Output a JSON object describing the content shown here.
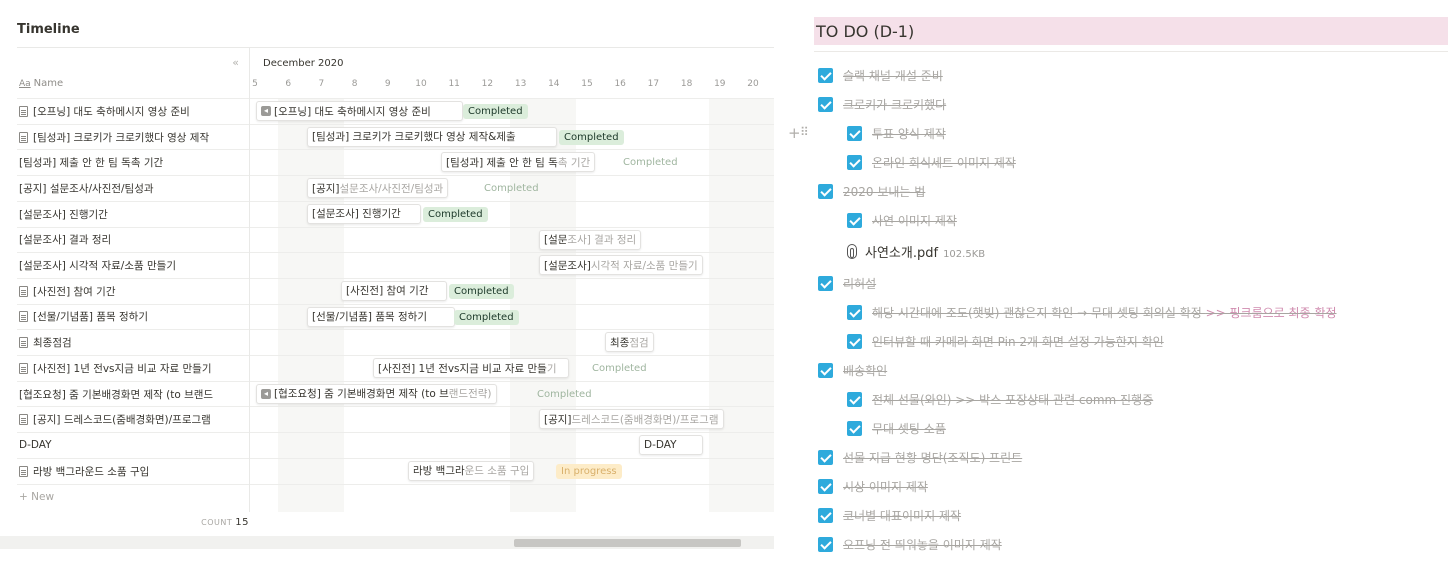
{
  "timeline": {
    "title": "Timeline",
    "collapse_icon": "«",
    "name_header_icon": "Aa",
    "name_header": "Name",
    "month": "December 2020",
    "days": [
      "5",
      "6",
      "7",
      "8",
      "9",
      "10",
      "11",
      "12",
      "13",
      "14",
      "15",
      "16",
      "17",
      "18",
      "19",
      "20"
    ],
    "rows": [
      {
        "name": "[오프닝] 대도 축하메시지 영상 준비",
        "doc": true
      },
      {
        "name": "[팀성과] 크로키가 크로키했다 영상 제작",
        "doc": true
      },
      {
        "name": "[팀성과] 제출 안 한 팀 독촉 기간",
        "doc": false
      },
      {
        "name": "[공지] 설문조사/사진전/팀성과",
        "doc": false
      },
      {
        "name": "[설문조사] 진행기간",
        "doc": false
      },
      {
        "name": "[설문조사] 결과 정리",
        "doc": false
      },
      {
        "name": "[설문조사] 시각적 자료/소품 만들기",
        "doc": false
      },
      {
        "name": "[사진전] 참여 기간",
        "doc": true
      },
      {
        "name": "[선물/기념품] 품목 정하기",
        "doc": true
      },
      {
        "name": "최종점검",
        "doc": true
      },
      {
        "name": "[사진전] 1년 전vs지금 비교 자료 만들기",
        "doc": true
      },
      {
        "name": "[협조요청] 줌 기본배경화면 제작 (to 브랜드",
        "doc": false
      },
      {
        "name": "[공지] 드레스코드(줌배경화면)/프로그램",
        "doc": true
      },
      {
        "name": "D-DAY",
        "doc": false
      },
      {
        "name": "라방 백그라운드 소품 구입",
        "doc": true
      }
    ],
    "new_label": "+ New",
    "count_label": "COUNT",
    "count_value": "15",
    "bars": [
      {
        "text": "[오프닝] 대도 축하메시지 영상 준비",
        "rest": "",
        "status": "Completed",
        "arrow": true
      },
      {
        "text": "[팀성과] 크로키가 크로키했다 영상 제작&제출",
        "rest": "",
        "status": "Completed",
        "arrow": false
      },
      {
        "text": "[팀성과] 제출 안 한 팀 독",
        "rest": "촉 기간",
        "status": "Completed",
        "arrow": false
      },
      {
        "text": "[공지]",
        "rest": " 설문조사/사진전/팀성과",
        "status": "Completed",
        "arrow": false
      },
      {
        "text": "[설문조사] 진행기간",
        "rest": "",
        "status": "Completed",
        "arrow": false
      },
      {
        "text": "[설문",
        "rest": "조사] 결과 정리",
        "status": "",
        "arrow": false
      },
      {
        "text": "[설문조사]",
        "rest": " 시각적 자료/소품 만들기",
        "status": "",
        "arrow": false
      },
      {
        "text": "[사진전] 참여 기간",
        "rest": "",
        "status": "Completed",
        "arrow": false
      },
      {
        "text": "[선물/기념품] 품목 정하기",
        "rest": "",
        "status": "Completed",
        "arrow": false
      },
      {
        "text": "최종",
        "rest": "점검",
        "status": "",
        "arrow": false
      },
      {
        "text": "[사진전] 1년 전vs지금 비교 자료 만들",
        "rest": "기",
        "status": "Completed",
        "arrow": false
      },
      {
        "text": "[협조요청] 줌 기본배경화면 제작 (to 브",
        "rest": "랜드전략)",
        "status": "Completed",
        "arrow": true
      },
      {
        "text": "[공지]",
        "rest": " 드레스코드(줌배경화면)/프로그램",
        "status": "",
        "arrow": false
      },
      {
        "text": "D-DAY",
        "rest": "",
        "status": "",
        "arrow": false
      },
      {
        "text": "라방 백그라",
        "rest": "운드 소품 구입",
        "status": "In progress",
        "arrow": false
      }
    ]
  },
  "todo": {
    "title": "TO DO (D-1)",
    "items": [
      {
        "text": "슬랙 채널 개설 준비",
        "indent": 0,
        "type": "check"
      },
      {
        "text": "크로키가 크로키했다",
        "indent": 0,
        "type": "check"
      },
      {
        "text": "투표 양식 제작",
        "indent": 1,
        "type": "check"
      },
      {
        "text": "온라인 회식세트 이미지 제작",
        "indent": 1,
        "type": "check"
      },
      {
        "text": "2020 보내는 법",
        "indent": 0,
        "type": "check"
      },
      {
        "text": "사연 이미지 제작",
        "indent": 1,
        "type": "check"
      },
      {
        "text": "사연소개.pdf",
        "size": "102.5KB",
        "indent": 1,
        "type": "file"
      },
      {
        "text": "리허설",
        "indent": 0,
        "type": "check"
      },
      {
        "text": "해당 시간대에 조도(햇빛) 괜찮은지 확인 → 무대 셋팅 회의실 확정 ",
        "highlight": ">> 핑크룸으로 최종 확정",
        "indent": 1,
        "type": "check"
      },
      {
        "text": "인터뷰할 때 카메라 화면 Pin 2개 화면 설정 가능한지 확인",
        "indent": 1,
        "type": "check"
      },
      {
        "text": "배송확인",
        "indent": 0,
        "type": "check"
      },
      {
        "text": "전체 선물(와인) >> 박스 포장상태 관련 comm 진행중",
        "indent": 1,
        "type": "check"
      },
      {
        "text": "무대 셋팅 소품",
        "indent": 1,
        "type": "check"
      },
      {
        "text": "선물 지급 현황 명단(조직도) 프린트",
        "indent": 0,
        "type": "check"
      },
      {
        "text": "시상 이미지 제작",
        "indent": 0,
        "type": "check"
      },
      {
        "text": "코너별 대표이미지 제작",
        "indent": 0,
        "type": "check"
      },
      {
        "text": "오프닝 전 띄워놓을 이미지 제작",
        "indent": 0,
        "type": "check"
      }
    ],
    "drag_handle_icon": "⠿",
    "add_icon": "+"
  },
  "colors": {
    "checkbox": "#2eaadc",
    "todo_header_bg": "#f5e0e9",
    "completed_badge_bg": "#dbeddb",
    "in_progress_badge_bg": "#fdecc8",
    "highlight_text": "#d08caf"
  }
}
